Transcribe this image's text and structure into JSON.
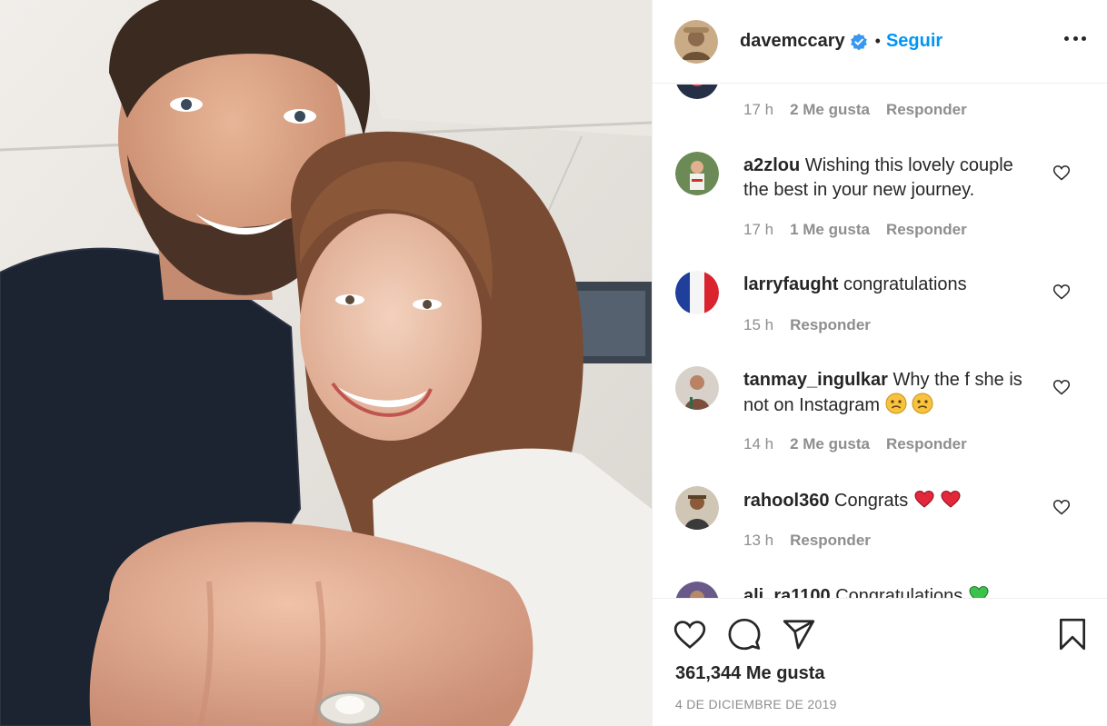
{
  "post": {
    "username": "davemccary",
    "follow_label": "Seguir",
    "separator": "•",
    "likes": "361,344 Me gusta",
    "date": "4 DE DICIEMBRE DE 2019"
  },
  "partial_top_comment": {
    "time": "17 h",
    "likes": "2 Me gusta",
    "reply": "Responder"
  },
  "comments": [
    {
      "username": "a2zlou",
      "text": "Wishing this lovely couple the best in your new journey.",
      "time": "17 h",
      "likes": "1 Me gusta",
      "reply": "Responder"
    },
    {
      "username": "larryfaught",
      "text": "congratulations",
      "time": "15 h",
      "likes": "",
      "reply": "Responder"
    },
    {
      "username": "tanmay_ingulkar",
      "text": "Why the f she is not on Instagram",
      "emojis": [
        "worried-face",
        "worried-face"
      ],
      "time": "14 h",
      "likes": "2 Me gusta",
      "reply": "Responder"
    },
    {
      "username": "rahool360",
      "text": "Congrats",
      "emojis": [
        "red-heart",
        "red-heart"
      ],
      "time": "13 h",
      "likes": "",
      "reply": "Responder"
    },
    {
      "username": "ali_ra1100",
      "text": "Congratulations",
      "emojis": [
        "green-heart"
      ]
    }
  ],
  "icons": {
    "verified": "verified-badge-icon",
    "more": "more-options-icon",
    "like": "heart-icon",
    "comment": "comment-icon",
    "share": "paper-plane-icon",
    "save": "bookmark-icon"
  },
  "colors": {
    "accent": "#0095f6",
    "text": "#262626",
    "muted": "#8e8e8e",
    "divider": "#efefef"
  }
}
